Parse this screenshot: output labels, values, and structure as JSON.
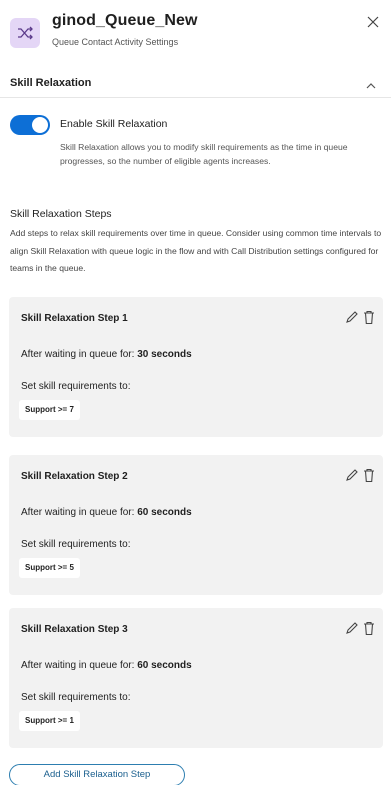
{
  "header": {
    "title": "ginod_Queue_New",
    "subtitle": "Queue Contact Activity Settings"
  },
  "section": {
    "title": "Skill Relaxation"
  },
  "toggle": {
    "label": "Enable Skill Relaxation",
    "enabled": true,
    "description": "Skill Relaxation allows you to modify skill requirements as the time in queue progresses, so the number of eligible agents increases."
  },
  "steps_section": {
    "title": "Skill Relaxation Steps",
    "description": "Add steps to relax skill requirements over time in queue. Consider using common time intervals to align Skill Relaxation with queue logic in the flow and with Call Distribution settings configured for teams in the queue."
  },
  "steps": [
    {
      "title": "Skill Relaxation Step 1",
      "wait_prefix": "After waiting in queue for: ",
      "wait_value": "30 seconds",
      "req_label": "Set skill requirements to:",
      "requirement": "Support >= 7"
    },
    {
      "title": "Skill Relaxation Step 2",
      "wait_prefix": "After waiting in queue for: ",
      "wait_value": "60 seconds",
      "req_label": "Set skill requirements to:",
      "requirement": "Support >= 5"
    },
    {
      "title": "Skill Relaxation Step 3",
      "wait_prefix": "After waiting in queue for: ",
      "wait_value": "60 seconds",
      "req_label": "Set skill requirements to:",
      "requirement": "Support >= 1"
    }
  ],
  "add_button": {
    "label": "Add Skill Relaxation Step"
  },
  "icons": {
    "queue": "shuffle-icon",
    "close": "close-icon",
    "collapse": "chevron-up-icon",
    "edit": "pencil-icon",
    "delete": "trash-icon"
  },
  "colors": {
    "accent": "#0d6fd6",
    "queue_icon_bg": "#e4d6f6",
    "card_bg": "#f2f2f2",
    "add_button_border": "#2d7eb0"
  }
}
